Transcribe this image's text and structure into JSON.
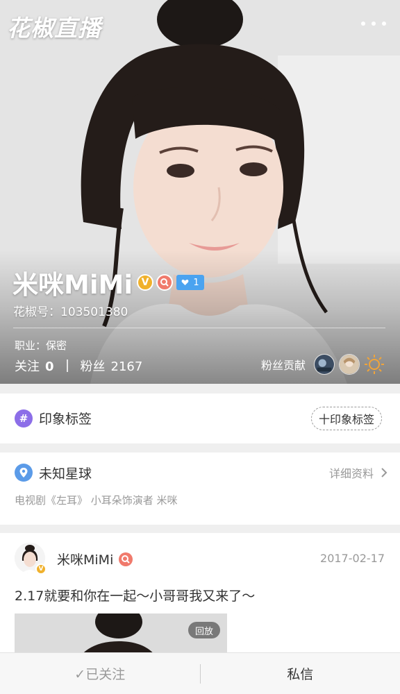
{
  "header": {
    "app_logo": "花椒直播",
    "more_icon": "more-dots-icon"
  },
  "profile": {
    "name": "米咪MiMi",
    "level": "1",
    "id_line": "花椒号：103501380",
    "job_line": "职业：保密",
    "following_label": "关注",
    "following_count": "0",
    "fans_label": "粉丝",
    "fans_count": "2167",
    "contribution_label": "粉丝贡献",
    "colors": {
      "level_badge": "#4aa3f0",
      "verified": "#f0b12c",
      "star_badge": "#f07a6c"
    }
  },
  "tags_section": {
    "icon": "hash-icon",
    "title": "印象标签",
    "add_button": "十印象标签"
  },
  "location_section": {
    "icon": "location-pin-icon",
    "title": "未知星球",
    "detail_link": "详细资料",
    "bio": "电视剧《左耳》 小耳朵饰演者 米咪"
  },
  "post": {
    "author": "米咪MiMi",
    "date": "2017-02-17",
    "text": "2.17就要和你在一起～小哥哥我又来了～",
    "replay_label": "回放"
  },
  "bottom_bar": {
    "follow_button": "✓已关注",
    "message_button": "私信"
  }
}
